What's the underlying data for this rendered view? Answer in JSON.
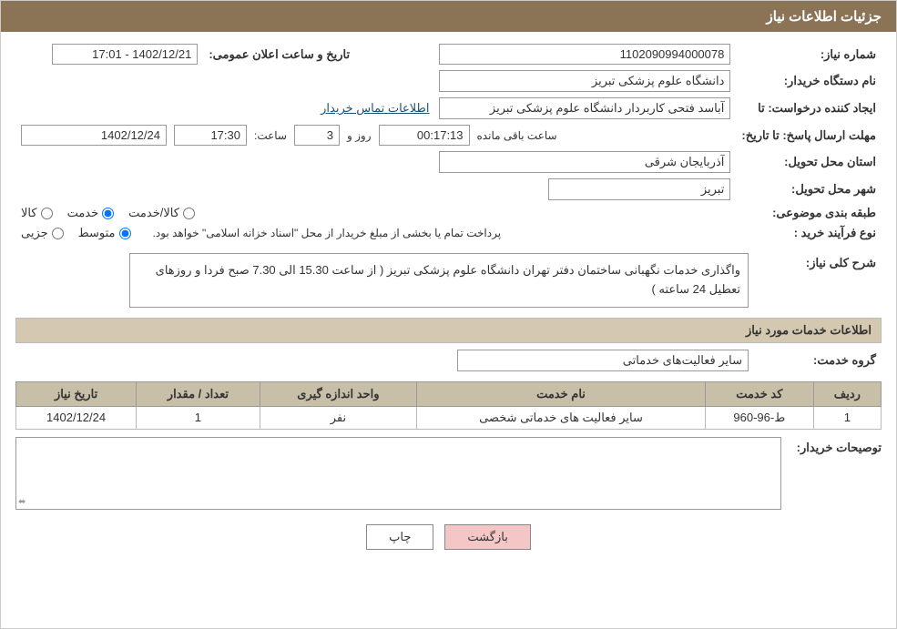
{
  "header": {
    "title": "جزئیات اطلاعات نیاز"
  },
  "fields": {
    "shomareNiaz_label": "شماره نیاز:",
    "shomareNiaz_value": "1102090994000078",
    "namDastgah_label": "نام دستگاه خریدار:",
    "namDastgah_value": "دانشگاه علوم پزشکی تبریز",
    "tarikh_label": "تاریخ و ساعت اعلان عمومی:",
    "tarikh_value": "1402/12/21 - 17:01",
    "ijadKonande_label": "ایجاد کننده درخواست: تا",
    "ijadKonande_value": "آباسد فتحی کاربردار دانشگاه علوم پزشکی تبریز",
    "ijadKonande_link": "اطلاعات تماس خریدار",
    "mohlat_label": "مهلت ارسال پاسخ: تا تاریخ:",
    "mohlat_date": "1402/12/24",
    "mohlat_saet_label": "ساعت:",
    "mohlat_saet": "17:30",
    "mohlat_roz_label": "روز و",
    "mohlat_roz": "3",
    "mohlat_baqi_label": "ساعت باقی مانده",
    "mohlat_timer": "00:17:13",
    "ostan_label": "استان محل تحویل:",
    "ostan_value": "آذربایجان شرقی",
    "shahr_label": "شهر محل تحویل:",
    "shahr_value": "تبریز",
    "tabaqe_label": "طبقه بندی موضوعی:",
    "tabaqe_options": [
      "کالا",
      "خدمت",
      "کالا/خدمت"
    ],
    "tabaqe_selected": "خدمت",
    "noeFarayand_label": "نوع فرآیند خرید :",
    "noeFarayand_options": [
      "جزیی",
      "متوسط"
    ],
    "noeFarayand_selected": "متوسط",
    "noeFarayand_note": "پرداخت تمام یا بخشی از مبلغ خریدار از محل \"اسناد خزانه اسلامی\" خواهد بود.",
    "sharh_label": "شرح کلی نیاز:",
    "sharh_text": "واگذاری خدمات نگهبانی ساختمان دفتر تهران دانشگاه علوم پزشکی تبریز ( از ساعت 15.30 الی 7.30 صبح فردا و روزهای تعطیل 24 ساعته )",
    "khadamat_header": "اطلاعات خدمات مورد نیاز",
    "groheKhadamat_label": "گروه خدمت:",
    "groheKhadamat_value": "سایر فعالیت‌های خدماتی",
    "table": {
      "headers": [
        "ردیف",
        "کد خدمت",
        "نام خدمت",
        "واحد اندازه گیری",
        "تعداد / مقدار",
        "تاریخ نیاز"
      ],
      "rows": [
        {
          "radif": "1",
          "kodKhadamat": "ط-96-960",
          "namKhadamat": "سایر فعالیت های خدماتی شخصی",
          "vahed": "نفر",
          "tedad": "1",
          "tarikh": "1402/12/24"
        }
      ]
    },
    "toseih_label": "توصیحات خریدار:",
    "toseih_value": ""
  },
  "buttons": {
    "back_label": "بازگشت",
    "print_label": "چاپ"
  }
}
